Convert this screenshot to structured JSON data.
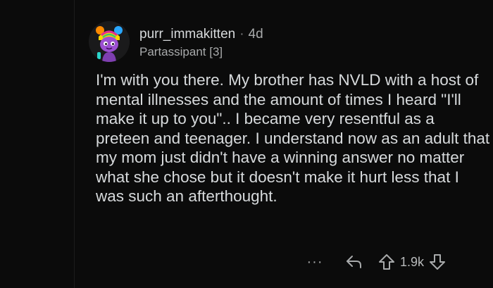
{
  "comment": {
    "username": "purr_immakitten",
    "separator": "·",
    "age": "4d",
    "flair": "Partassipant [3]",
    "body": "I'm with you there. My brother has NVLD with a host of mental illnesses and the amount of times I heard \"I'll make it up to you\".. I became very resentful as a preteen and teenager. I understand now as an adult that my mom just didn't have a winning answer no matter what she chose but it doesn't make it hurt less that I was such an afterthought.",
    "more_label": "···",
    "score": "1.9k"
  },
  "icons": {
    "avatar": "cat-avatar",
    "reply": "reply-arrow-icon",
    "upvote": "upvote-arrow-icon",
    "downvote": "downvote-arrow-icon"
  },
  "colors": {
    "background": "#0b0b0b",
    "text": "#d7dadc",
    "meta": "#a8aaab"
  }
}
